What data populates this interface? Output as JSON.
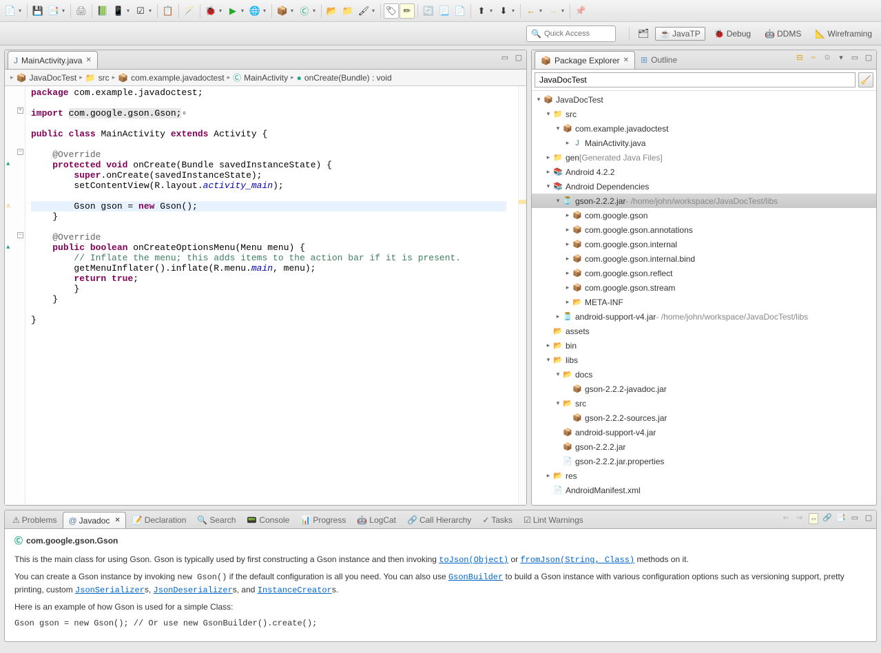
{
  "quickaccess_placeholder": "Quick Access",
  "perspectives": [
    "JavaTP",
    "Debug",
    "DDMS",
    "Wireframing"
  ],
  "editor": {
    "tab_label": "MainActivity.java",
    "breadcrumb": [
      "JavaDocTest",
      "src",
      "com.example.javadoctest",
      "MainActivity",
      "onCreate(Bundle) : void"
    ]
  },
  "code": {
    "l1a": "package",
    "l1b": " com.example.javadoctest;",
    "l2a": "import ",
    "l2b": "com.google.gson.Gson;",
    "l3a": "public",
    "l3b": " ",
    "l3c": "class",
    "l3d": " MainActivity ",
    "l3e": "extends",
    "l3f": " Activity {",
    "l4": "    @Override",
    "l5a": "    ",
    "l5b": "protected",
    "l5c": " ",
    "l5d": "void",
    "l5e": " onCreate(Bundle savedInstanceState) {",
    "l6a": "        ",
    "l6b": "super",
    "l6c": ".onCreate(savedInstanceState);",
    "l7a": "        setContentView(R.layout.",
    "l7b": "activity_main",
    "l7c": ");",
    "l8a": "        Gson gson = ",
    "l8b": "new",
    "l8c": " Gson();",
    "l9": "    }",
    "l10": "    @Override",
    "l11a": "    ",
    "l11b": "public",
    "l11c": " ",
    "l11d": "boolean",
    "l11e": " onCreateOptionsMenu(Menu menu) {",
    "l12": "        // Inflate the menu; this adds items to the action bar if it is present.",
    "l13a": "        getMenuInflater().inflate(R.menu.",
    "l13b": "main",
    "l13c": ", menu);",
    "l14a": "        ",
    "l14b": "return",
    "l14c": " ",
    "l14d": "true",
    "l14e": ";",
    "l15": "        }",
    "l16": "    }",
    "l17": "}"
  },
  "package_explorer": {
    "title": "Package Explorer",
    "outline": "Outline",
    "filter": "JavaDocTest",
    "tree": {
      "project": "JavaDocTest",
      "src": "src",
      "pkg": "com.example.javadoctest",
      "mainact": "MainActivity.java",
      "gen": "gen",
      "gen_note": " [Generated Java Files]",
      "android": "Android 4.2.2",
      "deps": "Android Dependencies",
      "gsonjar": "gson-2.2.2.jar",
      "gsonjar_note": " - /home/john/workspace/JavaDocTest/libs",
      "p1": "com.google.gson",
      "p2": "com.google.gson.annotations",
      "p3": "com.google.gson.internal",
      "p4": "com.google.gson.internal.bind",
      "p5": "com.google.gson.reflect",
      "p6": "com.google.gson.stream",
      "meta": "META-INF",
      "support": "android-support-v4.jar",
      "support_note": " - /home/john/workspace/JavaDocTest/libs",
      "assets": "assets",
      "bin": "bin",
      "libs": "libs",
      "docs": "docs",
      "javadocjar": "gson-2.2.2-javadoc.jar",
      "libsrc": "src",
      "sourcesjar": "gson-2.2.2-sources.jar",
      "supportjar2": "android-support-v4.jar",
      "gsonjar2": "gson-2.2.2.jar",
      "gsonprops": "gson-2.2.2.jar.properties",
      "res": "res",
      "manifest": "AndroidManifest.xml"
    }
  },
  "bottom_tabs": [
    "Problems",
    "Javadoc",
    "Declaration",
    "Search",
    "Console",
    "Progress",
    "LogCat",
    "Call Hierarchy",
    "Tasks",
    "Lint Warnings"
  ],
  "javadoc": {
    "title": "com.google.gson.Gson",
    "p1a": "This is the main class for using Gson. Gson is typically used by first constructing a Gson instance and then invoking ",
    "link1": "toJson(Object)",
    "p1b": " or ",
    "link2": "fromJson(String, Class)",
    "p1c": " methods on it.",
    "p2a": "You can create a Gson instance by invoking ",
    "p2code": "new Gson()",
    "p2b": " if the default configuration is all you need. You can also use ",
    "link3": "GsonBuilder",
    "p2c": " to build a Gson instance with various configuration options such as versioning support, pretty printing, custom ",
    "link4": "JsonSerializer",
    "p2d": "s, ",
    "link5": "JsonDeserializer",
    "p2e": "s, and ",
    "link6": "InstanceCreator",
    "p2f": "s.",
    "p3": "Here is an example of how Gson is used for a simple Class:",
    "code1": " Gson gson = new Gson(); // Or use new GsonBuilder().create();"
  }
}
